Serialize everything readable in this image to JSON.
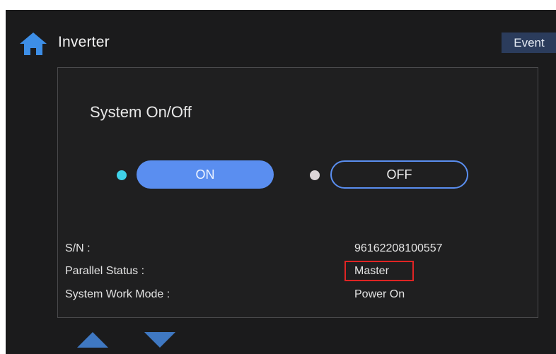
{
  "header": {
    "title": "Inverter",
    "home_icon": "home-icon",
    "event_label": "Event"
  },
  "panel": {
    "title": "System On/Off",
    "on_label": "ON",
    "off_label": "OFF",
    "selected": "ON",
    "info": [
      {
        "label": "S/N :",
        "value": "96162208100557"
      },
      {
        "label": "Parallel Status :",
        "value": "Master"
      },
      {
        "label": "System Work Mode :",
        "value": "Power On"
      }
    ]
  },
  "navigation": {
    "up_icon": "triangle-up-icon",
    "down_icon": "triangle-down-icon"
  },
  "colors": {
    "accent": "#5a8ef0",
    "on_indicator": "#3fd2e9",
    "off_indicator": "#dcd5d8",
    "highlight": "#e02424",
    "background": "#1b1b1c"
  }
}
